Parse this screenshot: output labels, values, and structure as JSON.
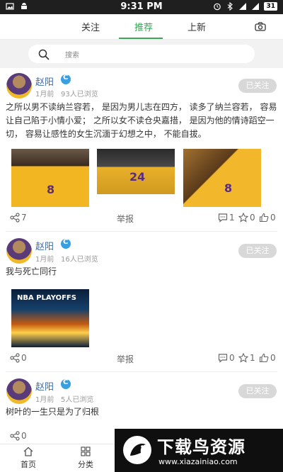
{
  "status_bar": {
    "time": "9:31 PM",
    "battery": "31"
  },
  "tabs": [
    {
      "label": "关注"
    },
    {
      "label": "推荐"
    },
    {
      "label": "上新"
    }
  ],
  "search": {
    "placeholder": "搜索"
  },
  "posts": [
    {
      "user": "赵阳",
      "time": "1月前",
      "views": "93人已浏览",
      "follow_label": "已关注",
      "text": "之所以男不读纳兰容若，  是因为男儿志在四方，  读多了纳兰容若，  容易让自己陷于小情小爱；  之所以女不读仓央嘉措，  是因为他的情诗蹈空一切，  容易让感性的女生沉湎于幻想之中，  不能自拔。",
      "shares": "7",
      "report": "举报",
      "comments": "1",
      "stars": "0",
      "likes": "0"
    },
    {
      "user": "赵阳",
      "time": "1月前",
      "views": "16人已浏览",
      "follow_label": "已关注",
      "text": "我与死亡同行",
      "image_text": "NBA PLAYOFFS",
      "shares": "0",
      "report": "举报",
      "comments": "0",
      "stars": "1",
      "likes": "0"
    },
    {
      "user": "赵阳",
      "time": "1月前",
      "views": "5人已浏览",
      "follow_label": "已关注",
      "text": "树叶的一生只是为了归根",
      "shares": "0"
    }
  ],
  "bottom_nav": [
    {
      "label": "首页",
      "icon": "home-icon"
    },
    {
      "label": "分类",
      "icon": "grid-icon"
    }
  ],
  "watermark": {
    "title": "下载鸟资源",
    "url": "www.xiazainiao.com"
  },
  "colors": {
    "accent": "#3aa858",
    "username": "#3d6ba8",
    "follow_bg": "#d8d8d8"
  }
}
